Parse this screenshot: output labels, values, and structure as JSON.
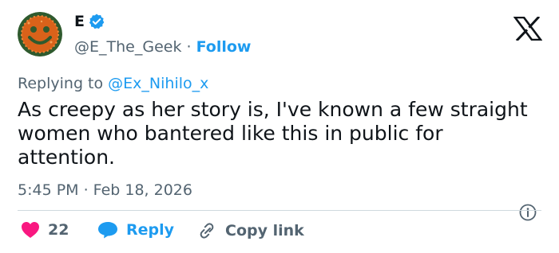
{
  "author": {
    "display_name": "E",
    "handle": "@E_The_Geek",
    "separator": "·",
    "follow_label": "Follow"
  },
  "reply_context": {
    "prefix": "Replying to",
    "mention": "@Ex_Nihilo_x"
  },
  "tweet": {
    "text": "As creepy as her story is, I've known a few straight women who bantered like this in public for attention.",
    "timestamp": "5:45 PM · Feb 18, 2026"
  },
  "actions": {
    "like_count": "22",
    "reply_label": "Reply",
    "copy_label": "Copy link"
  },
  "colors": {
    "link_blue": "#1d9bf0",
    "muted_text": "#536471",
    "like_red": "#f91880",
    "avatar_green": "#2f5a2e",
    "avatar_orange": "#e0691c"
  },
  "icons": [
    "verified-badge-icon",
    "x-logo-icon",
    "info-icon",
    "heart-icon",
    "reply-bubble-icon",
    "link-icon"
  ]
}
